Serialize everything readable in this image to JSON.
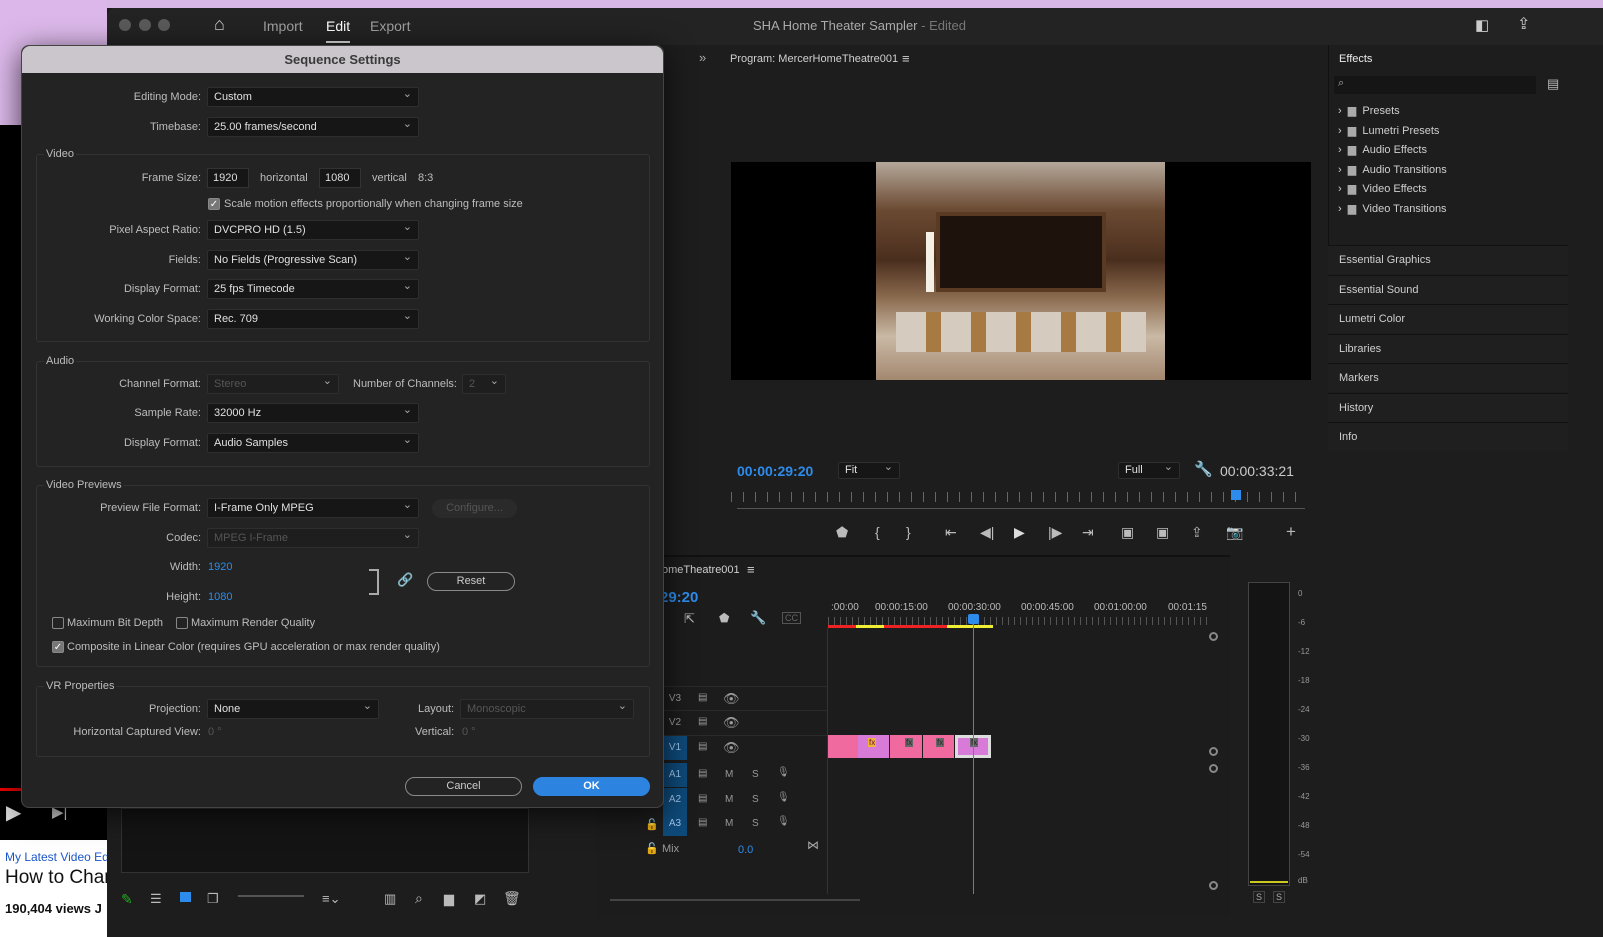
{
  "app": {
    "title": "SHA Home Theater Sampler",
    "title_suffix": "- Edited",
    "nav": [
      "Import",
      "Edit",
      "Export"
    ],
    "active_nav": "Edit"
  },
  "browser": {
    "link": "My Latest Video Edi",
    "heading": "How to Char",
    "views": "190,404 views  J"
  },
  "program": {
    "title": "Program: MercerHomeTheatre001",
    "timecode": "00:00:29:20",
    "zoom": "Fit",
    "quality": "Full",
    "duration": "00:00:33:21"
  },
  "effects": {
    "title": "Effects",
    "items": [
      "Presets",
      "Lumetri Presets",
      "Audio Effects",
      "Audio Transitions",
      "Video Effects",
      "Video Transitions"
    ],
    "panels": [
      "Essential Graphics",
      "Essential Sound",
      "Lumetri Color",
      "Libraries",
      "Markers",
      "History",
      "Info"
    ]
  },
  "timeline": {
    "title": "omeTheatre001",
    "timecode": "29:20",
    "ruler": [
      ":00:00",
      "00:00:15:00",
      "00:00:30:00",
      "00:00:45:00",
      "00:01:00:00",
      "00:01:15"
    ],
    "video_tracks": [
      "V3",
      "V2",
      "V1"
    ],
    "audio_tracks": [
      "A1",
      "A2",
      "A3"
    ],
    "mute": "M",
    "solo": "S",
    "mix_label": "Mix",
    "mix_value": "0.0",
    "fx": "fx"
  },
  "meter": {
    "ticks": [
      "0",
      "-6",
      "-12",
      "-18",
      "-24",
      "-30",
      "-36",
      "-42",
      "-48",
      "-54",
      "dB"
    ],
    "solo": [
      "S",
      "S"
    ]
  },
  "dialog": {
    "title": "Sequence Settings",
    "editing_mode_label": "Editing Mode:",
    "editing_mode": "Custom",
    "timebase_label": "Timebase:",
    "timebase": "25.00  frames/second",
    "video": {
      "group": "Video",
      "frame_size_label": "Frame Size:",
      "width": "1920",
      "horizontal": "horizontal",
      "height": "1080",
      "vertical": "vertical",
      "ratio": "8:3",
      "scale_label": "Scale motion effects proportionally when changing frame size",
      "scale_checked": true,
      "par_label": "Pixel Aspect Ratio:",
      "par": "DVCPRO HD (1.5)",
      "fields_label": "Fields:",
      "fields": "No Fields (Progressive Scan)",
      "display_label": "Display Format:",
      "display": "25 fps Timecode",
      "color_label": "Working Color Space:",
      "color": "Rec. 709"
    },
    "audio": {
      "group": "Audio",
      "channel_label": "Channel Format:",
      "channel": "Stereo",
      "num_label": "Number of Channels:",
      "num": "2",
      "rate_label": "Sample Rate:",
      "rate": "32000 Hz",
      "display_label": "Display Format:",
      "display": "Audio Samples"
    },
    "previews": {
      "group": "Video Previews",
      "format_label": "Preview File Format:",
      "format": "I-Frame Only MPEG",
      "configure": "Configure...",
      "codec_label": "Codec:",
      "codec": "MPEG I-Frame",
      "width_label": "Width:",
      "width": "1920",
      "height_label": "Height:",
      "height": "1080",
      "reset": "Reset",
      "max_bit_depth": "Maximum Bit Depth",
      "max_bit_depth_checked": false,
      "max_render": "Maximum Render Quality",
      "max_render_checked": false,
      "linear": "Composite in Linear Color (requires GPU acceleration or max render quality)",
      "linear_checked": true
    },
    "vr": {
      "group": "VR Properties",
      "projection_label": "Projection:",
      "projection": "None",
      "layout_label": "Layout:",
      "layout": "Monoscopic",
      "hview_label": "Horizontal Captured View:",
      "hview": "0 °",
      "vertical_label": "Vertical:",
      "vertical": "0 °"
    },
    "cancel": "Cancel",
    "ok": "OK"
  },
  "colors": {
    "accent": "#2d8ceb",
    "clip_pink": "#f06aa0",
    "clip_violet": "#d87ad8",
    "ok_button": "#2d84e0"
  }
}
